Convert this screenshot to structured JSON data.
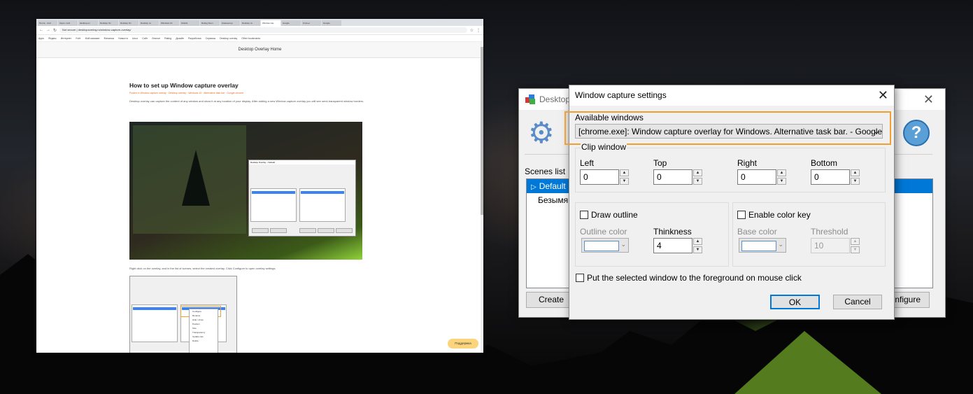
{
  "browser": {
    "tabs": [
      "Почта - rsvd",
      "rayan -rsvd",
      "desktop-ov",
      "Desktop Ov",
      "Desktop Ov",
      "Desktop ov",
      "Windows 10",
      "GitHub",
      "Debug Scen",
      "Компьютер",
      "Desktop ov",
      "Window cap",
      "Google",
      "Статьи",
      "Google"
    ],
    "active_tab_index": 11,
    "address": "Not secure | desktopoverlay.ru/window-capture-overlay/",
    "bookmarks": [
      "Apps",
      "Яндекс",
      "Интернет",
      "Учёт",
      "Мой магазин",
      "Финансы",
      "Новости",
      "Linux",
      "Сайт",
      "Личное",
      "Rating",
      "Дизайн",
      "Разработка",
      "Сервисы",
      "Desktop overlay",
      "Other bookmarks"
    ],
    "site_header": "Desktop Overlay   Home",
    "post_title": "How to set up Window capture overlay",
    "post_meta": "Posted in Window capture overlay · Desktop overlay · Windows 10 · Alternative task bar · Google chrome",
    "post_para": "Desktop overlay can capture the content of any window and show it at any location of your display. After adding a new Window capture overlay you will see semi-transparent window borders.",
    "post_para2": "Right click on the overlay, and in the list of scenes, select the created overlay. Click Configure to open overlay settings.",
    "mini_title": "Desktop Overlay – Default",
    "mini_menu": [
      "Configure",
      "Rename",
      "Hide / show",
      "Position",
      "Size",
      "Transparency",
      "Update rate",
      "Delete"
    ],
    "help_pill": "Поддержка"
  },
  "main_window": {
    "title": "Desktop Overlay",
    "scenes_label": "Scenes list",
    "scenes": [
      "Default",
      "Безымянный"
    ],
    "create_label": "Create",
    "configure_label": "Configure"
  },
  "dialog": {
    "title": "Window capture settings",
    "available_label": "Available windows",
    "selected_window": "[chrome.exe]: Window capture overlay for Windows. Alternative task bar. - Google Chrome",
    "clip_label": "Clip window",
    "left_label": "Left",
    "left_value": "0",
    "top_label": "Top",
    "top_value": "0",
    "right_label": "Right",
    "right_value": "0",
    "bottom_label": "Bottom",
    "bottom_value": "0",
    "draw_outline_label": "Draw outline",
    "outline_color_label": "Outline color",
    "thickness_label": "Thinkness",
    "thickness_value": "4",
    "color_key_label": "Enable color key",
    "base_color_label": "Base color",
    "threshold_label": "Threshold",
    "threshold_value": "10",
    "foreground_label": "Put the selected window to the foreground on mouse click",
    "ok_label": "OK",
    "cancel_label": "Cancel"
  },
  "colors": {
    "accent": "#0078d7",
    "highlight": "#f0a030",
    "selection": "#0078d7"
  }
}
